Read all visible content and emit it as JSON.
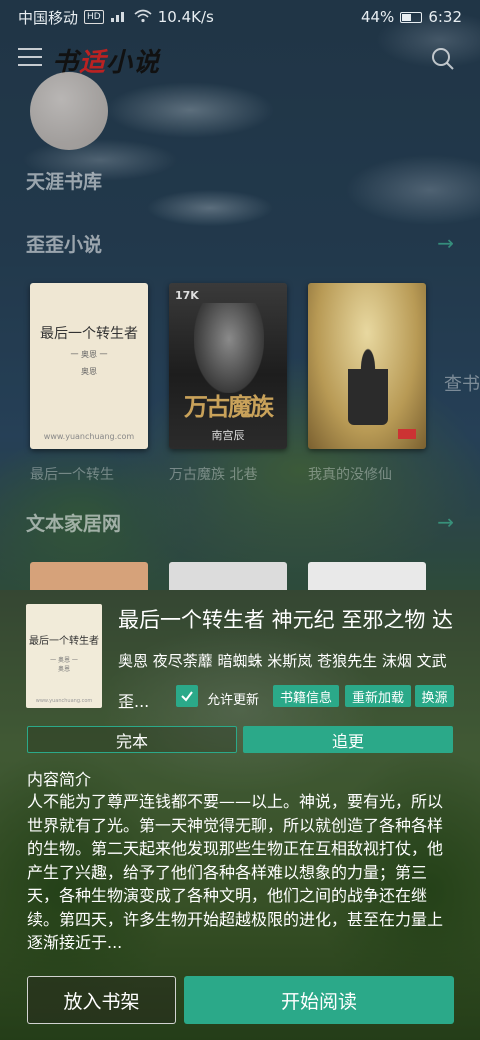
{
  "status_bar": {
    "carrier": "中国移动",
    "hd": "HD",
    "signal": "4G",
    "speed": "10.4K/s",
    "battery": "44%",
    "time": "6:32"
  },
  "app": {
    "logo_left": "书",
    "logo_mid": "适",
    "logo_right": "小说",
    "accent_color": "#2ba989"
  },
  "sources": [
    {
      "name": "天涯书库"
    },
    {
      "name": "歪歪小说"
    },
    {
      "name": "文本家居网"
    }
  ],
  "covers": [
    {
      "title": "最后一个转生者",
      "line1": "一 奥恩 一",
      "line2": "奥恩",
      "footer": "www.yuanchuang.com",
      "caption": "最后一个转生"
    },
    {
      "brand": "17K",
      "title_art": "万古魔族",
      "author": "南宫辰",
      "caption": "万古魔族 北巷"
    },
    {
      "caption": "我真的没修仙"
    }
  ],
  "side_text": "查书",
  "detail": {
    "cover": {
      "title": "最后一个转生者",
      "line1": "一 奥恩 一",
      "line2": "奥恩",
      "footer": "www.yuanchuang.com"
    },
    "title": "最后一个转生者 神元纪 至邪之物 达",
    "authors": "奥恩 夜尽荼蘼 暗蜘蛛 米斯岚 苍狼先生 沫烟 文武",
    "source_short": "歪...",
    "allow_update": "允许更新",
    "chips": [
      "书籍信息",
      "重新加载",
      "换源"
    ],
    "status_complete": "完本",
    "status_update": "追更",
    "intro_heading": "内容简介",
    "intro": "人不能为了尊严连钱都不要——以上。神说，要有光，所以世界就有了光。第一天神觉得无聊，所以就创造了各种各样的生物。第二天起来他发现那些生物正在互相敌视打仗，他产生了兴趣，给予了他们各种各样难以想象的力量；第三天，各种生物演变成了各种文明，他们之间的战争还在继续。第四天，许多生物开始超越极限的进化，甚至在力量上逐渐接近于...",
    "add_to_shelf": "放入书架",
    "start_reading": "开始阅读"
  }
}
